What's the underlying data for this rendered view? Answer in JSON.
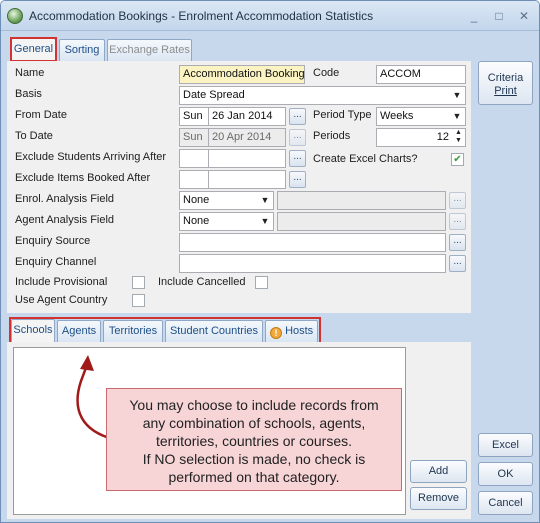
{
  "window": {
    "title": "Accommodation Bookings - Enrolment Accommodation Statistics",
    "minimize": "_",
    "maximize": "□",
    "close": "✕"
  },
  "top_tabs": [
    {
      "label": "General"
    },
    {
      "label": "Sorting"
    },
    {
      "label": "Exchange Rates"
    }
  ],
  "form": {
    "name_label": "Name",
    "name_value": "Accommodation Booking",
    "code_label": "Code",
    "code_value": "ACCOM",
    "basis_label": "Basis",
    "basis_value": "Date Spread",
    "from_date_label": "From Date",
    "from_day": "Sun",
    "from_date": "26 Jan 2014",
    "to_date_label": "To Date",
    "to_day": "Sun",
    "to_date": "20 Apr 2014",
    "period_type_label": "Period Type",
    "period_type_value": "Weeks",
    "periods_label": "Periods",
    "periods_value": "12",
    "exclude_arriving_label": "Exclude Students Arriving After",
    "create_excel_label": "Create Excel Charts?",
    "exclude_booked_label": "Exclude Items Booked After",
    "enrol_field_label": "Enrol. Analysis Field",
    "enrol_field_value": "None",
    "agent_field_label": "Agent Analysis Field",
    "agent_field_value": "None",
    "enquiry_source_label": "Enquiry Source",
    "enquiry_channel_label": "Enquiry Channel",
    "include_provisional_label": "Include Provisional",
    "include_cancelled_label": "Include Cancelled",
    "use_agent_country_label": "Use Agent Country"
  },
  "lower_tabs": [
    {
      "label": "Schools"
    },
    {
      "label": "Agents"
    },
    {
      "label": "Territories"
    },
    {
      "label": "Student Countries"
    },
    {
      "label": "Hosts"
    }
  ],
  "callout": {
    "lines": [
      "You may choose to include records from",
      "any combination of schools, agents,",
      "territories, countries or courses.",
      "If NO selection is made, no check is",
      "performed on that category."
    ]
  },
  "buttons": {
    "add": "Add",
    "remove": "Remove",
    "criteria_line1": "Criteria",
    "criteria_line2": "Print",
    "excel": "Excel",
    "ok": "OK",
    "cancel": "Cancel"
  },
  "glyphs": {
    "dropdown": "▼",
    "ellipsis": "...",
    "check": "✔",
    "spin_up": "▲",
    "spin_down": "▼",
    "warning": "!"
  },
  "colors": {
    "highlight_box": "#d33232",
    "callout_bg": "#f7d4d6",
    "check": "#3a9a3a"
  }
}
